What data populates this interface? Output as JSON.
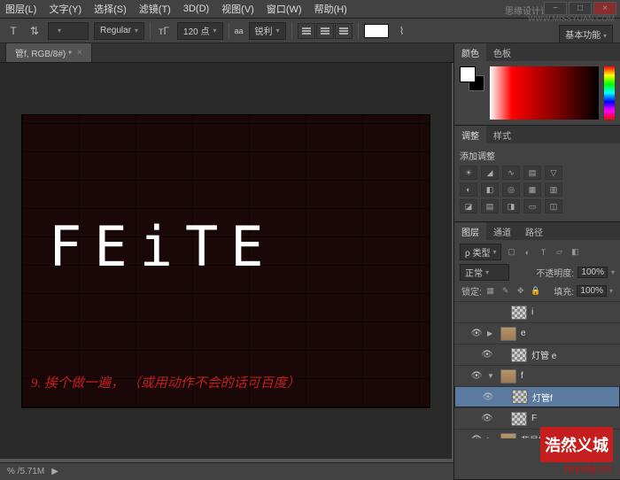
{
  "menu": {
    "items": [
      "图层(L)",
      "文字(Y)",
      "选择(S)",
      "滤镜(T)",
      "3D(D)",
      "视图(V)",
      "窗口(W)",
      "帮助(H)"
    ]
  },
  "watermark": "思缘设计论坛",
  "url": "WWW.MISSYUAN.COM",
  "toolbar": {
    "font_family": "",
    "font_style": "Regular",
    "font_size": "120 点",
    "aa_label": "aa",
    "aa_mode": "锐利"
  },
  "essentials": "基本功能",
  "tab": {
    "title": "管f, RGB/8#) *"
  },
  "canvas": {
    "text": "FEiTE"
  },
  "annotation": "9. 挨个做一遍，  （或用动作不会的话可百度）",
  "status": {
    "zoom_doc": "% /5.71M"
  },
  "panel_color": {
    "tab1": "颜色",
    "tab2": "色板"
  },
  "panel_adj": {
    "tab1": "调整",
    "tab2": "样式",
    "title": "添加调整"
  },
  "panel_layers": {
    "tabs": [
      "图层",
      "通道",
      "路径"
    ],
    "kind": "ρ 类型",
    "blend": "正常",
    "opacity_label": "不透明度:",
    "opacity": "100%",
    "lock_label": "锁定:",
    "fill_label": "填充:",
    "fill": "100%",
    "layers": [
      {
        "eye": "",
        "indent": 2,
        "thumb": "checker",
        "name": "i",
        "sel": false
      },
      {
        "eye": "👁",
        "indent": 1,
        "fold": "▶",
        "thumb": "folder",
        "name": "e",
        "sel": false
      },
      {
        "eye": "👁",
        "indent": 2,
        "thumb": "checker",
        "name": "灯管 e",
        "sel": false
      },
      {
        "eye": "👁",
        "indent": 1,
        "fold": "▼",
        "thumb": "folder",
        "name": "f",
        "sel": false
      },
      {
        "eye": "👁",
        "indent": 2,
        "thumb": "checker",
        "name": "灯管f",
        "sel": true
      },
      {
        "eye": "👁",
        "indent": 2,
        "thumb": "checker",
        "name": "F",
        "sel": false
      },
      {
        "eye": "👁",
        "indent": 1,
        "fold": "▶",
        "thumb": "folder",
        "name": "背景拷贝组",
        "sel": false
      }
    ]
  },
  "brand": {
    "text": "浩然义城",
    "url": "hryckj.cn"
  }
}
